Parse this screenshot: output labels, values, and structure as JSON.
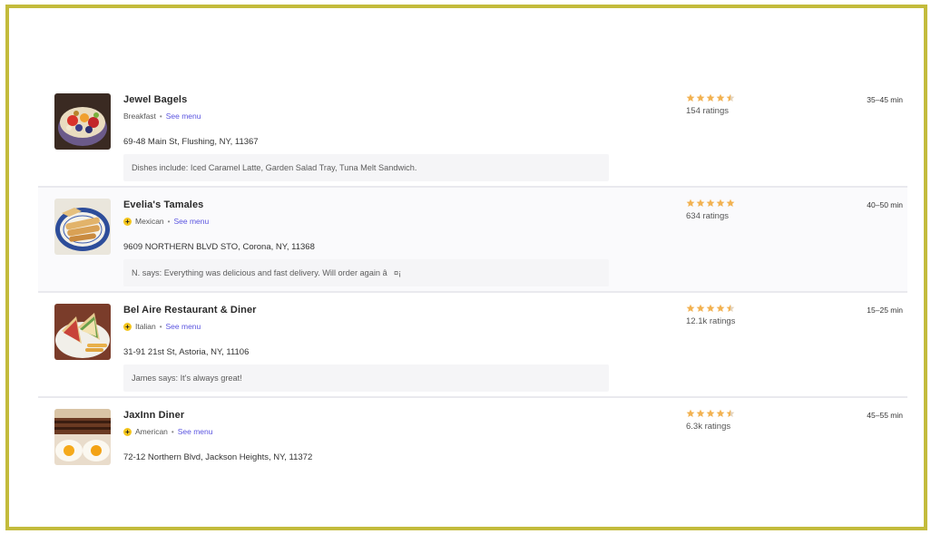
{
  "restaurants": [
    {
      "name": "Jewel Bagels",
      "cuisine": "Breakfast",
      "show_badge": false,
      "see_menu": "See menu",
      "address": "69-48 Main St, Flushing, NY, 11367",
      "review": "Dishes include: Iced Caramel Latte, Garden Salad Tray, Tuna Melt Sandwich.",
      "rating_value": 4.5,
      "ratings_count": "154 ratings",
      "delivery_time": "35–45 min",
      "thumb_icon": "fruit-bowl-photo"
    },
    {
      "name": "Evelia's Tamales",
      "cuisine": "Mexican",
      "show_badge": true,
      "see_menu": "See menu",
      "address": "9609 NORTHERN BLVD STO, Corona, NY, 11368",
      "review": "N. says: Everything was delicious and fast delivery. Will order again â¤¡",
      "rating_value": 5,
      "ratings_count": "634 ratings",
      "delivery_time": "40–50 min",
      "thumb_icon": "tamales-plate-photo"
    },
    {
      "name": "Bel Aire Restaurant & Diner",
      "cuisine": "Italian",
      "show_badge": true,
      "see_menu": "See menu",
      "address": "31-91 21st St, Astoria, NY, 11106",
      "review": "James says: It's always great!",
      "rating_value": 4.5,
      "ratings_count": "12.1k ratings",
      "delivery_time": "15–25 min",
      "thumb_icon": "club-sandwich-photo"
    },
    {
      "name": "JaxInn Diner",
      "cuisine": "American",
      "show_badge": true,
      "see_menu": "See menu",
      "address": "72-12 Northern Blvd, Jackson Heights, NY, 11372",
      "review": "",
      "rating_value": 4.5,
      "ratings_count": "6.3k ratings",
      "delivery_time": "45–55 min",
      "thumb_icon": "eggs-steak-photo"
    }
  ],
  "colors": {
    "frame_border": "#c3bb3c",
    "star": "#f2b252",
    "link": "#5b55e0",
    "badge": "#f4c51c"
  },
  "badge_glyph": "+",
  "separator": "•"
}
